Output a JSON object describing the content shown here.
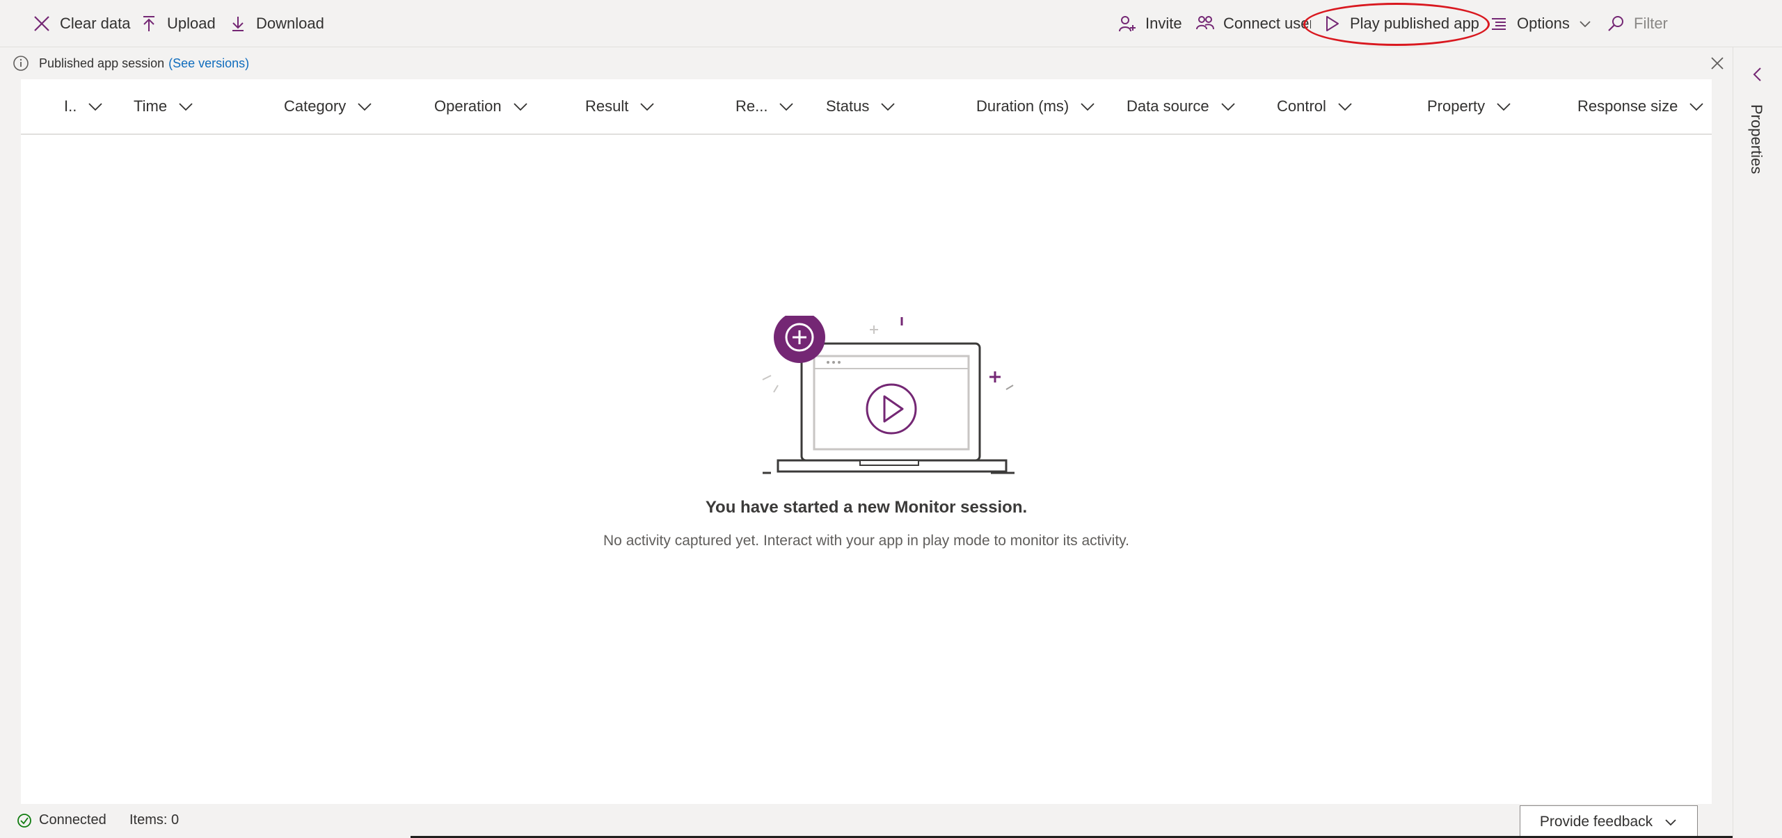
{
  "toolbar": {
    "clear_label": "Clear data",
    "upload_label": "Upload",
    "download_label": "Download",
    "invite_label": "Invite",
    "connect_label": "Connect user",
    "play_label": "Play published app",
    "options_label": "Options",
    "filter_placeholder": "Filter"
  },
  "infobar": {
    "text": "Published app session",
    "link": "(See versions)"
  },
  "columns": [
    "I..",
    "Time",
    "Category",
    "Operation",
    "Result",
    "Re...",
    "Status",
    "Duration (ms)",
    "Data source",
    "Control",
    "Property",
    "Response size"
  ],
  "empty_state": {
    "title": "You have started a new Monitor session.",
    "subtitle": "No activity captured yet. Interact with your app in play mode to monitor its activity."
  },
  "right_panel": {
    "label": "Properties"
  },
  "status": {
    "connected": "Connected",
    "items": "Items: 0"
  },
  "feedback_label": "Provide feedback",
  "colors": {
    "accent": "#742774",
    "highlight": "#d9181f",
    "link": "#0f6cbd",
    "success": "#107c10"
  },
  "icons": [
    "close-x-icon",
    "upload-icon",
    "download-icon",
    "invite-person-icon",
    "connect-users-icon",
    "play-icon",
    "options-icon",
    "chevron-down-icon",
    "search-icon",
    "info-icon",
    "chevron-left-icon",
    "check-circle-icon"
  ]
}
